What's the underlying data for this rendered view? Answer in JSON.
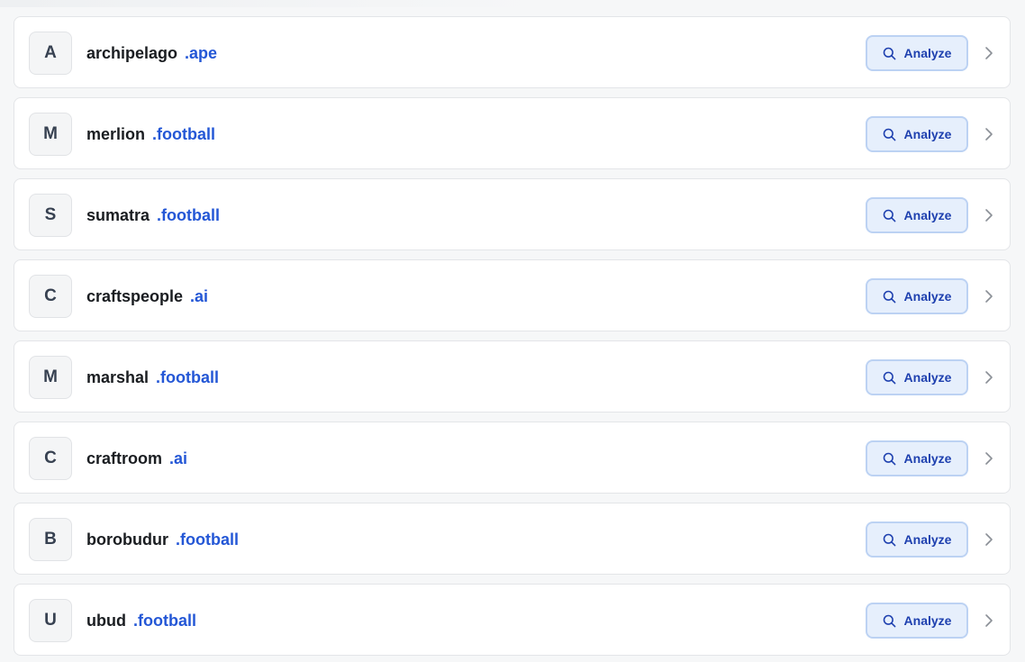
{
  "analyze_label": "Analyze",
  "colors": {
    "tld": "#2457d6",
    "button_bg": "#e6effc",
    "button_text": "#1e40af"
  },
  "icons": {
    "analyze": "search-icon",
    "row_action": "chevron-right-icon"
  },
  "items": [
    {
      "initial": "A",
      "name": "archipelago",
      "tld": ".ape"
    },
    {
      "initial": "M",
      "name": "merlion",
      "tld": ".football"
    },
    {
      "initial": "S",
      "name": "sumatra",
      "tld": ".football"
    },
    {
      "initial": "C",
      "name": "craftspeople",
      "tld": ".ai"
    },
    {
      "initial": "M",
      "name": "marshal",
      "tld": ".football"
    },
    {
      "initial": "C",
      "name": "craftroom",
      "tld": ".ai"
    },
    {
      "initial": "B",
      "name": "borobudur",
      "tld": ".football"
    },
    {
      "initial": "U",
      "name": "ubud",
      "tld": ".football"
    }
  ]
}
